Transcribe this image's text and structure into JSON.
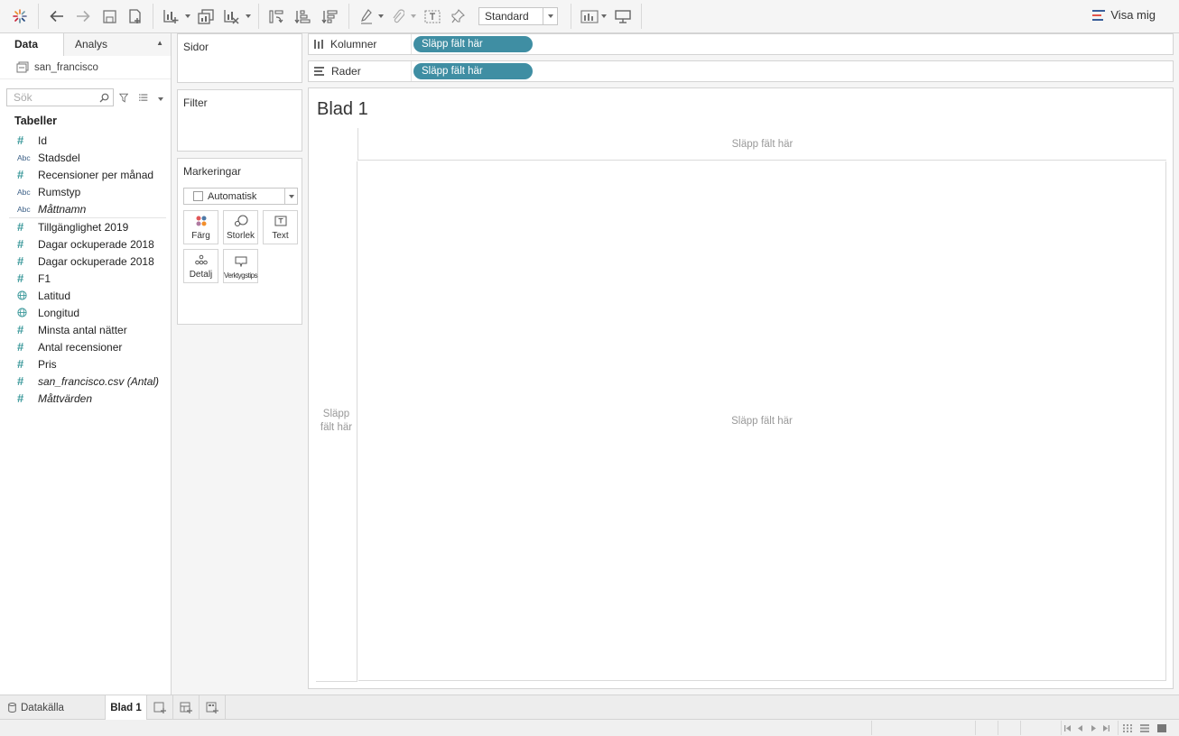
{
  "toolbar": {
    "view_mode": "Standard",
    "show_me_label": "Visa mig",
    "icons": [
      "tableau-logo-icon",
      "undo-icon",
      "redo-icon",
      "save-icon",
      "add-datasource-icon",
      "new-sheet-icon",
      "duplicate-sheet-icon",
      "clear-sheet-icon",
      "swap-icon",
      "sort-ascending-icon",
      "sort-descending-icon",
      "highlight-icon",
      "group-icon",
      "labels-icon",
      "fix-axes-icon",
      "fit-icon",
      "presentation-icon"
    ]
  },
  "data_pane": {
    "tab_data": "Data",
    "tab_analysis": "Analys",
    "datasource": "san_francisco",
    "search_placeholder": "Sök",
    "tables_header": "Tabeller",
    "fields": [
      {
        "type": "num",
        "name": "Id"
      },
      {
        "type": "abc",
        "name": "Stadsdel"
      },
      {
        "type": "num",
        "name": "Recensioner per månad"
      },
      {
        "type": "abc",
        "name": "Rumstyp"
      },
      {
        "type": "abc",
        "name": "Måttnamn",
        "italic": true
      }
    ],
    "measures": [
      {
        "type": "num",
        "name": "Tillgänglighet 2019"
      },
      {
        "type": "num",
        "name": "Dagar ockuperade 2018"
      },
      {
        "type": "num",
        "name": "Dagar ockuperade 2018"
      },
      {
        "type": "num",
        "name": "F1"
      },
      {
        "type": "geo",
        "name": "Latitud"
      },
      {
        "type": "geo",
        "name": "Longitud"
      },
      {
        "type": "num",
        "name": "Minsta antal nätter"
      },
      {
        "type": "num",
        "name": "Antal recensioner"
      },
      {
        "type": "num",
        "name": "Pris"
      },
      {
        "type": "num",
        "name": "san_francisco.csv (Antal)",
        "italic": true
      },
      {
        "type": "num",
        "name": "Måttvärden",
        "italic": true
      }
    ]
  },
  "shelves": {
    "pages_title": "Sidor",
    "filter_title": "Filter",
    "marks_title": "Markeringar",
    "mark_type": "Automatisk",
    "mark_buttons": {
      "color": "Färg",
      "size": "Storlek",
      "text": "Text",
      "detail": "Detalj",
      "tooltip": "Verktygstips"
    },
    "columns_label": "Kolumner",
    "rows_label": "Rader",
    "drop_pill": "Släpp fält här"
  },
  "worksheet": {
    "title": "Blad 1",
    "drop_columns": "Släpp fält här",
    "drop_rows": "Släpp fält här",
    "drop_canvas": "Släpp fält här"
  },
  "sheet_tabs": {
    "datasource_tab": "Datakälla",
    "active_sheet": "Blad 1"
  },
  "colors": {
    "pill": "#3f8ea3",
    "numeric_icon": "#3e9a9c",
    "dimension_icon": "#3b5f86"
  }
}
